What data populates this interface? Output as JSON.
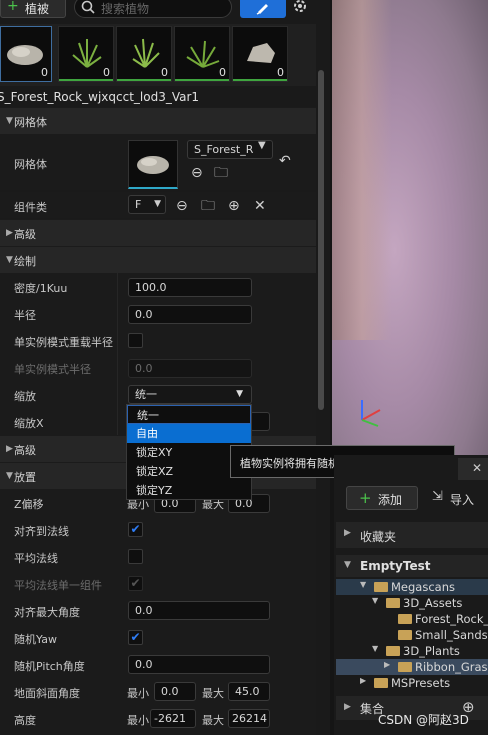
{
  "toolbar": {
    "mode_button": "植被",
    "search_placeholder": "搜索植物",
    "paint_icon": "brush-icon",
    "settings_icon": "gear-icon"
  },
  "thumbnails": [
    {
      "name": "rock-thumb-1",
      "count": "0",
      "selected": true
    },
    {
      "name": "grass-thumb-1",
      "count": "0"
    },
    {
      "name": "grass-thumb-2",
      "count": "0"
    },
    {
      "name": "grass-thumb-3",
      "count": "0"
    },
    {
      "name": "rock-thumb-2",
      "count": "0"
    }
  ],
  "asset_name": "S_Forest_Rock_wjxqcct_lod3_Var1",
  "sections": {
    "mesh": "网格体",
    "advanced1": "高级",
    "paint": "绘制",
    "advanced2": "高级",
    "placement": "放置"
  },
  "mesh": {
    "label": "网格体",
    "dropdown": "S_Forest_R",
    "component_label": "组件类",
    "component_value": "F"
  },
  "paint": {
    "density_label": "密度/1Kuu",
    "density_value": "100.0",
    "radius_label": "半径",
    "radius_value": "0.0",
    "single_override_label": "单实例模式重载半径",
    "single_radius_label": "单实例模式半径",
    "single_radius_value": "0.0",
    "scale_label": "缩放",
    "scale_value": "统一",
    "scalex_label": "缩放X"
  },
  "scale_dropdown": {
    "options": [
      "统一",
      "自由",
      "锁定XY",
      "锁定XZ",
      "锁定YZ"
    ],
    "highlighted": 1
  },
  "tooltip": "植物实例将拥有随机的X、Y和Z标度。",
  "placement": {
    "zoffset_label": "Z偏移",
    "min": "最小",
    "max": "最大",
    "zoffset_min": "0.0",
    "zoffset_max": "0.0",
    "align_normal_label": "对齐到法线",
    "avg_normal_label": "平均法线",
    "avg_single_label": "平均法线单一组件",
    "align_max_label": "对齐最大角度",
    "align_max_value": "0.0",
    "random_yaw_label": "随机Yaw",
    "random_pitch_label": "随机Pitch角度",
    "random_pitch_value": "0.0",
    "slope_label": "地面斜面角度",
    "slope_min": "0.0",
    "slope_max": "45.0",
    "height_label": "高度",
    "height_min": "-2621",
    "height_max": "26214"
  },
  "content_browser": {
    "add_button": "添加",
    "import_button": "导入",
    "favorites": "收藏夹",
    "project": "EmptyTest",
    "tree": [
      {
        "label": "Megascans",
        "level": 1
      },
      {
        "label": "3D_Assets",
        "level": 2
      },
      {
        "label": "Forest_Rock_",
        "level": 3
      },
      {
        "label": "Small_Sandst",
        "level": 3
      },
      {
        "label": "3D_Plants",
        "level": 2
      },
      {
        "label": "Ribbon_Grass",
        "level": 3
      },
      {
        "label": "MSPresets",
        "level": 1
      }
    ],
    "collections": "集合"
  },
  "watermark": "CSDN @阿赵3D",
  "colors": {
    "accent": "#1f6fd8",
    "highlight": "#0a6ed1",
    "checkbox_blue": "#2f7df6",
    "viewport": "#a88ba6"
  }
}
